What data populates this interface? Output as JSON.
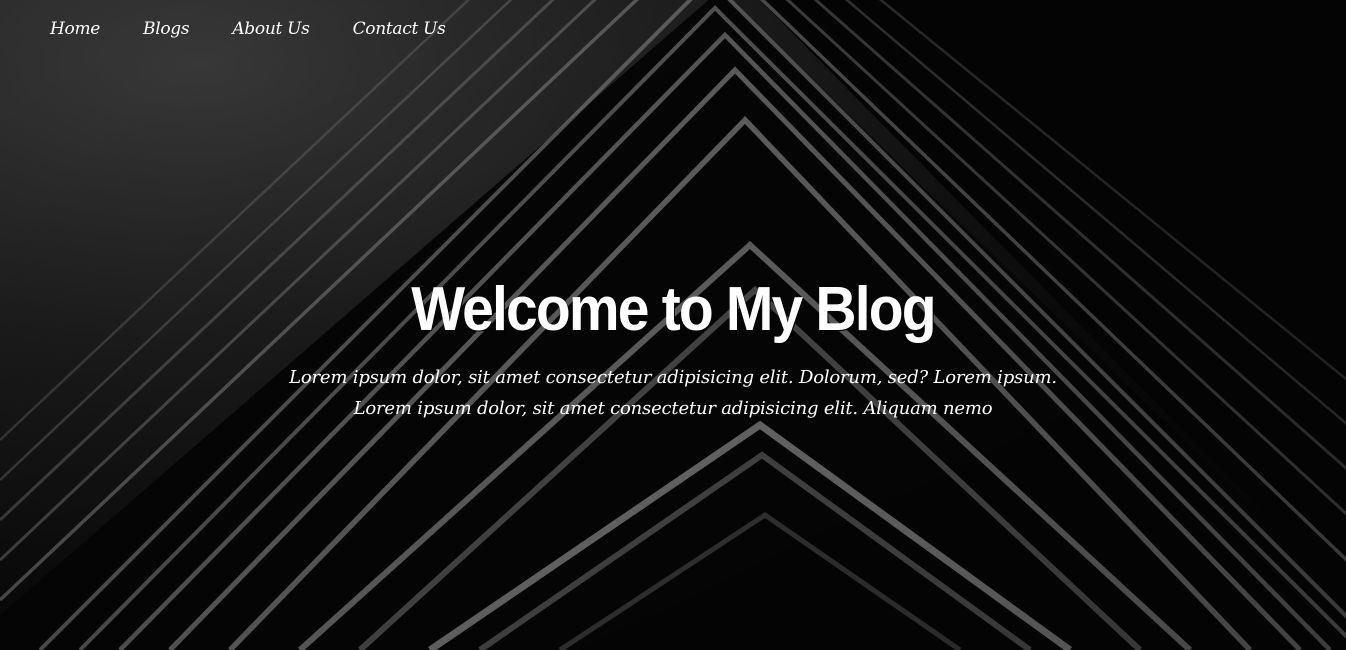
{
  "nav": {
    "items": [
      {
        "label": "Home"
      },
      {
        "label": "Blogs"
      },
      {
        "label": "About Us"
      },
      {
        "label": "Contact Us"
      }
    ]
  },
  "hero": {
    "title": "Welcome to My Blog",
    "subtitle": "Lorem ipsum dolor, sit amet consectetur adipisicing elit. Dolorum, sed? Lorem ipsum. Lorem ipsum dolor, sit amet consectetur adipisicing elit. Aliquam nemo"
  },
  "colors": {
    "background": "#050505",
    "text": "#ffffff",
    "stripe": "#9a9a9a"
  }
}
